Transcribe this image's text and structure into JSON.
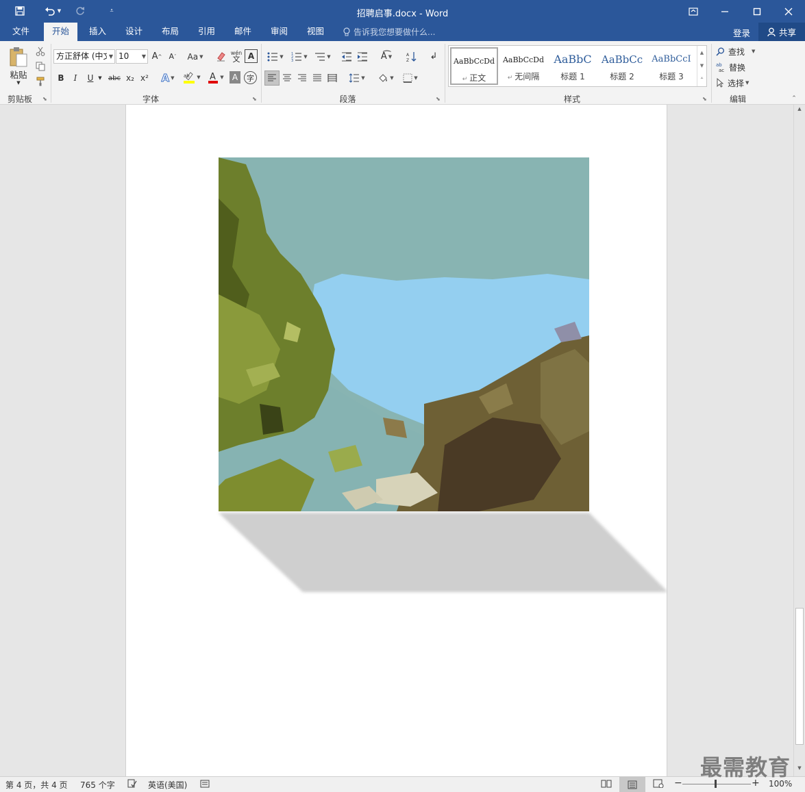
{
  "titlebar": {
    "document_title": "招聘启事.docx - Word",
    "qa_save_icon": "save-icon",
    "qa_undo_icon": "undo-icon",
    "qa_redo_icon": "redo-icon",
    "qa_customize_icon": "customize-icon"
  },
  "tabs": [
    {
      "label": "文件"
    },
    {
      "label": "开始"
    },
    {
      "label": "插入"
    },
    {
      "label": "设计"
    },
    {
      "label": "布局"
    },
    {
      "label": "引用"
    },
    {
      "label": "邮件"
    },
    {
      "label": "审阅"
    },
    {
      "label": "视图"
    }
  ],
  "tellme_placeholder": "告诉我您想要做什么...",
  "account": {
    "login": "登录",
    "share": "共享"
  },
  "ribbon": {
    "clipboard": {
      "paste": "粘贴",
      "label": "剪贴板"
    },
    "font": {
      "label": "字体",
      "font_name": "方正舒体 (中文",
      "font_size": "10",
      "change_case": "Aa",
      "phonetic": "wén",
      "bold": "B",
      "italic": "I",
      "underline": "U",
      "strike": "abc",
      "subscript": "x₂",
      "superscript": "x²"
    },
    "paragraph": {
      "label": "段落"
    },
    "styles": {
      "label": "样式",
      "items": [
        {
          "sample": "AaBbCcDd",
          "name": "正文"
        },
        {
          "sample": "AaBbCcDd",
          "name": "无间隔"
        },
        {
          "sample": "AaBbC",
          "name": "标题 1"
        },
        {
          "sample": "AaBbCc",
          "name": "标题 2"
        },
        {
          "sample": "AaBbCcI",
          "name": "标题 3"
        }
      ]
    },
    "editing": {
      "label": "编辑",
      "find": "查找",
      "replace": "替换",
      "select": "选择"
    }
  },
  "status": {
    "page": "第 4 页，共 4 页",
    "words": "765 个字",
    "language": "英语(美国)",
    "zoom": "100%"
  },
  "watermark": "最需教育",
  "colors": {
    "accent": "#2b579a",
    "sky": "#8ab5b3",
    "lake": "#94cff0",
    "foliage_green": "#6b7f2a",
    "foliage_brown": "#6f6036",
    "shadow": "#cfcfcf"
  }
}
